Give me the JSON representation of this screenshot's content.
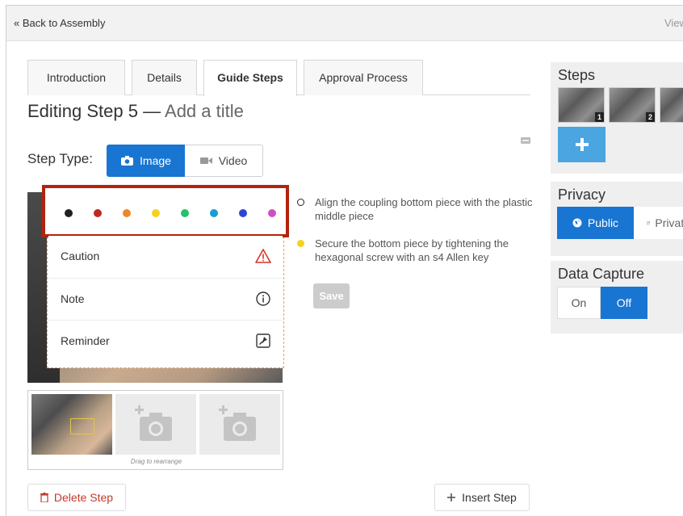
{
  "topbar": {
    "back_label": "« Back to Assembly",
    "view_label": "View"
  },
  "tabs": [
    {
      "label": "Introduction",
      "active": false
    },
    {
      "label": "Details",
      "active": false
    },
    {
      "label": "Guide Steps",
      "active": true
    },
    {
      "label": "Approval Process",
      "active": false
    }
  ],
  "editor": {
    "title_prefix": "Editing Step 5 —",
    "title_placeholder": "Add a title",
    "step_type_label": "Step Type:",
    "image_label": "Image",
    "video_label": "Video",
    "selected_type": "Image"
  },
  "bullet_menu": {
    "colors": [
      "#222222",
      "#c0281f",
      "#f0862a",
      "#f5d11e",
      "#23c16b",
      "#1a9cd0",
      "#2c46d4",
      "#cf4fc0"
    ],
    "items": [
      {
        "label": "Caution",
        "icon": "warning-icon",
        "icon_color": "#d9342b"
      },
      {
        "label": "Note",
        "icon": "info-icon",
        "icon_color": "#333333"
      },
      {
        "label": "Reminder",
        "icon": "pin-icon",
        "icon_color": "#333333"
      }
    ]
  },
  "bullets": [
    {
      "text": "Align the coupling bottom piece with the plastic middle piece",
      "color": "#222222"
    },
    {
      "text": "Secure the bottom piece by tightening the hexagonal screw with an s4 Allen key",
      "color": "#f5d11e"
    }
  ],
  "save_label": "Save",
  "media": {
    "drag_hint": "Drag to rearrange"
  },
  "actions": {
    "delete_label": "Delete Step",
    "insert_label": "Insert Step"
  },
  "sidebar": {
    "steps_title": "Steps",
    "step_numbers": [
      "1",
      "2"
    ],
    "privacy_title": "Privacy",
    "public_label": "Public",
    "private_label": "Private",
    "selected_privacy": "Public",
    "data_capture_title": "Data Capture",
    "on_label": "On",
    "off_label": "Off",
    "data_capture_state": "Off"
  },
  "colors": {
    "accent": "#1975d2",
    "highlight_border": "#b3230f",
    "danger": "#c0392b"
  }
}
